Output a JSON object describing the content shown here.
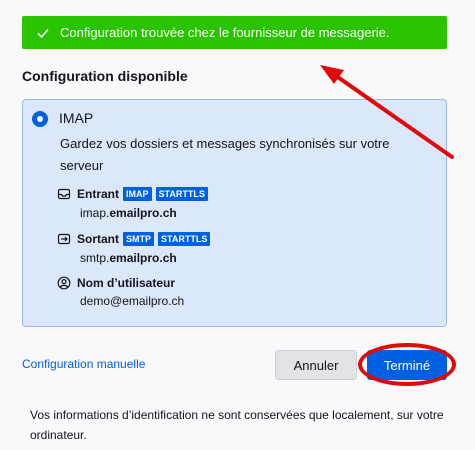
{
  "banner": {
    "text": "Configuration trouvée chez le fournisseur de messagerie."
  },
  "section_title": "Configuration disponible",
  "config": {
    "protocol": "IMAP",
    "description": "Gardez vos dossiers et messages synchronisés sur votre serveur",
    "incoming": {
      "label": "Entrant",
      "tags": [
        "IMAP",
        "STARTTLS"
      ],
      "host_prefix": "imap.",
      "host_domain": "emailpro.ch"
    },
    "outgoing": {
      "label": "Sortant",
      "tags": [
        "SMTP",
        "STARTTLS"
      ],
      "host_prefix": "smtp.",
      "host_domain": "emailpro.ch"
    },
    "username": {
      "label": "Nom d’utilisateur",
      "value": "demo@emailpro.ch"
    }
  },
  "actions": {
    "manual": "Configuration manuelle",
    "cancel": "Annuler",
    "done": "Terminé"
  },
  "footer": "Vos informations d’identification ne sont conservées que localement, sur votre ordinateur.",
  "colors": {
    "success": "#2ac300",
    "accent": "#0061e0",
    "annotation": "#e00a0a"
  },
  "icons": {
    "check": "check-icon",
    "incoming": "inbox-icon",
    "outgoing": "outbox-icon",
    "user": "user-icon"
  }
}
